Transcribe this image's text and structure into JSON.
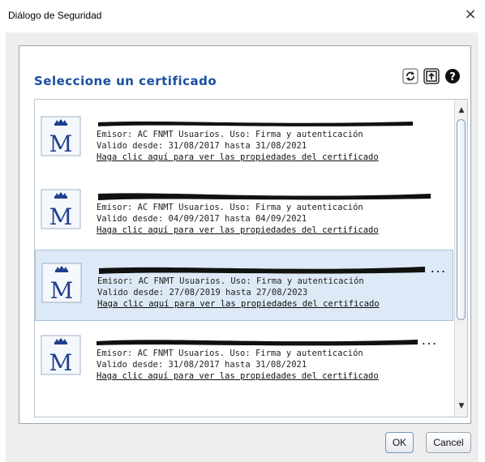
{
  "window": {
    "title": "Diálogo de Seguridad",
    "close_glyph": "×"
  },
  "dialog": {
    "heading": "Seleccione un certificado",
    "toolbar": {
      "refresh_icon": "refresh-icon",
      "export_icon": "export-icon",
      "help_icon": "help-icon"
    }
  },
  "certificates": [
    {
      "name_redacted": true,
      "issuer": "Emisor: AC FNMT Usuarios. Uso: Firma y autenticación",
      "validity": "Valido desde: 31/08/2017 hasta 31/08/2021",
      "link": "Haga clic aquí para ver las propiedades del certificado",
      "selected": false
    },
    {
      "name_redacted": true,
      "issuer": "Emisor: AC FNMT Usuarios. Uso: Firma y autenticación",
      "validity": "Valido desde: 04/09/2017 hasta 04/09/2021",
      "link": "Haga clic aquí para ver las propiedades del certificado",
      "selected": false
    },
    {
      "name_redacted": true,
      "name_suffix": "...",
      "issuer": "Emisor: AC FNMT Usuarios. Uso: Firma y autenticación",
      "validity": "Valido desde: 27/08/2019 hasta 27/08/2023",
      "link": "Haga clic aquí para ver las propiedades del certificado",
      "selected": true
    },
    {
      "name_redacted": true,
      "name_suffix": "...",
      "issuer": "Emisor: AC FNMT Usuarios. Uso: Firma y autenticación",
      "validity": "Valido desde: 31/08/2017 hasta 31/08/2021",
      "link": "Haga clic aquí para ver las propiedades del certificado",
      "selected": false
    }
  ],
  "buttons": {
    "ok": "OK",
    "cancel": "Cancel"
  },
  "colors": {
    "heading": "#1a4fa0",
    "selected_row": "#dde9f6",
    "logo_blue": "#1f3f8f"
  }
}
